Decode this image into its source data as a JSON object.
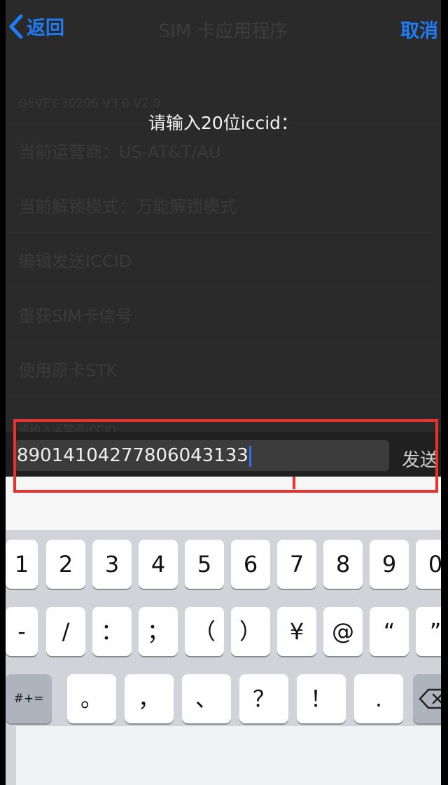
{
  "navbar": {
    "back_label": "返回",
    "title": "SIM 卡应用程序",
    "cancel_label": "取消"
  },
  "list": {
    "rows": [
      "GEVEY-30206 V3.0 V2.0",
      "当前运营商：US-AT&T/AU",
      "当前解锁模式：万能解锁模式",
      "编辑发送ICCID",
      "重获SIM卡信号",
      "使用原卡STK",
      "请输入运营商ICCID"
    ]
  },
  "prompt": "请输入20位iccid：",
  "input": {
    "value": "89014104277806043133",
    "send_label": "发送"
  },
  "keyboard": {
    "row1": [
      "1",
      "2",
      "3",
      "4",
      "5",
      "6",
      "7",
      "8",
      "9",
      "0"
    ],
    "row2": [
      "-",
      "/",
      "：",
      "；",
      "（",
      "）",
      "¥",
      "@",
      "“",
      "”"
    ],
    "row3_mode_label": "#+=",
    "row3": [
      "。",
      "，",
      "、",
      "？",
      "！",
      "."
    ]
  },
  "colors": {
    "accent_blue": "#1f7cf5",
    "highlight_red": "#e8322e",
    "caret_blue": "#2c6ff5"
  }
}
